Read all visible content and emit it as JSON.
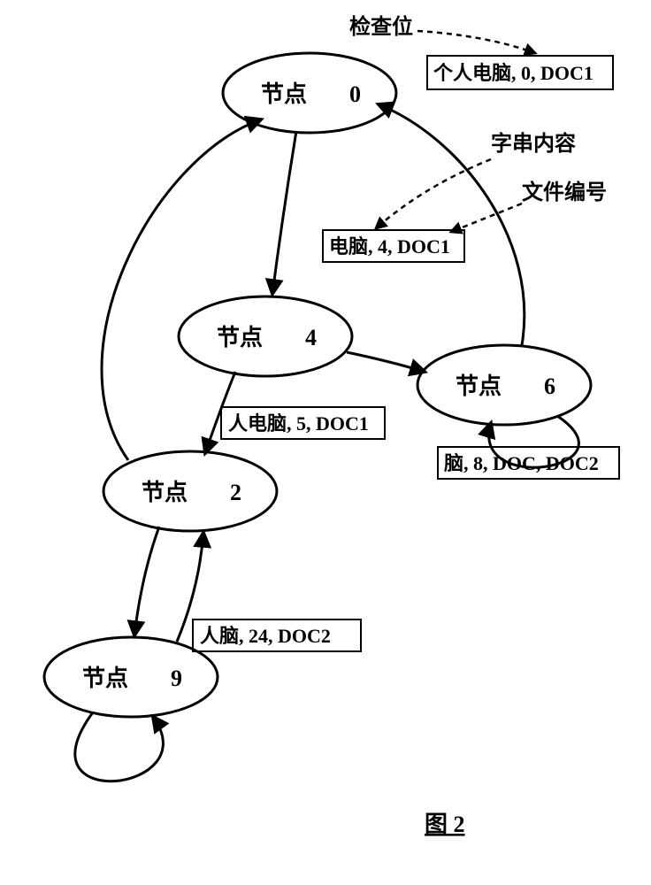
{
  "figure_label": "图 2",
  "annotations": {
    "check_bit": "检查位",
    "string_content": "字串内容",
    "file_number": "文件编号"
  },
  "nodes": {
    "n0": {
      "label_prefix": "节点",
      "num": "0"
    },
    "n4": {
      "label_prefix": "节点",
      "num": "4"
    },
    "n2": {
      "label_prefix": "节点",
      "num": "2"
    },
    "n6": {
      "label_prefix": "节点",
      "num": "6"
    },
    "n9": {
      "label_prefix": "节点",
      "num": "9"
    }
  },
  "boxes": {
    "b0": "个人电脑, 0, DOC1",
    "b4": "电脑, 4, DOC1",
    "b2": "人电脑, 5, DOC1",
    "b6": "脑, 8, DOC, DOC2",
    "b9": "人脑, 24, DOC2"
  }
}
